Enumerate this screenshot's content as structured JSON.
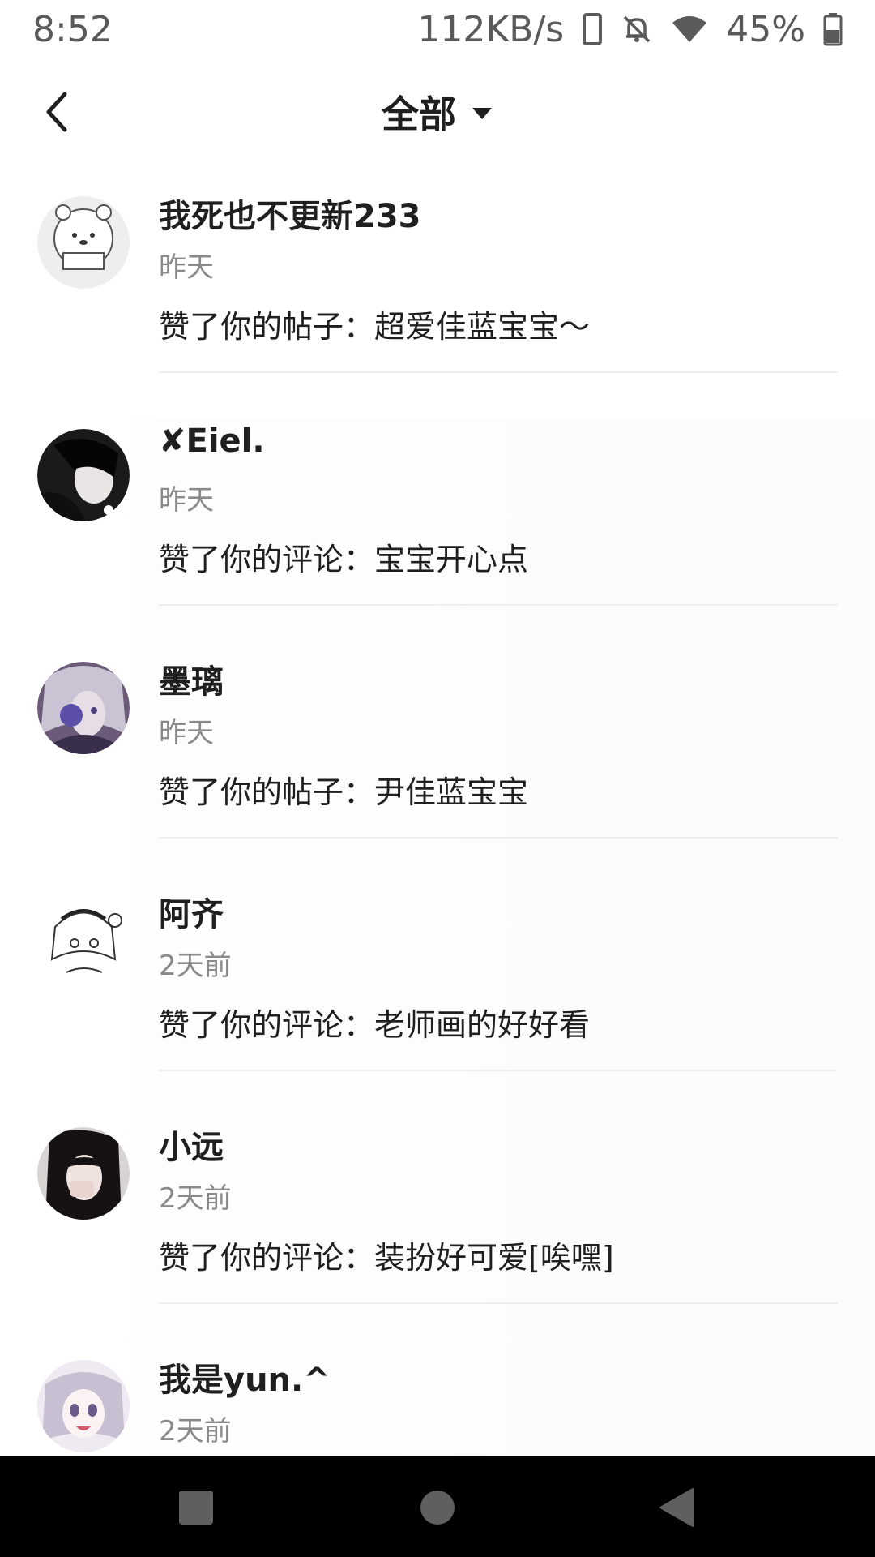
{
  "status_bar": {
    "time": "8:52",
    "net_speed": "112KB/s",
    "battery": "45%",
    "icons": [
      "phone-icon",
      "bell-off-icon",
      "wifi-icon",
      "battery-icon"
    ]
  },
  "header": {
    "title": "全部",
    "back_icon": "chevron-left-icon",
    "dropdown_icon": "caret-down-icon"
  },
  "notifications": [
    {
      "username": "我死也不更新233",
      "time": "昨天",
      "action": "赞了你的帖子：超爱佳蓝宝宝～"
    },
    {
      "username": "✘Eiel.",
      "time": "昨天",
      "action": "赞了你的评论：宝宝开心点"
    },
    {
      "username": "墨璃",
      "time": "昨天",
      "action": "赞了你的帖子：尹佳蓝宝宝"
    },
    {
      "username": "阿齐",
      "time": "2天前",
      "action": "赞了你的评论：老师画的好好看"
    },
    {
      "username": "小远",
      "time": "2天前",
      "action": "赞了你的评论：装扮好可爱[唉嘿]"
    },
    {
      "username": "我是yun.^",
      "time": "2天前",
      "action": ""
    }
  ],
  "colors": {
    "text_primary": "#1f1f1f",
    "text_secondary": "#8a8a8a",
    "divider": "#efefef",
    "nav_bar": "#000000"
  }
}
